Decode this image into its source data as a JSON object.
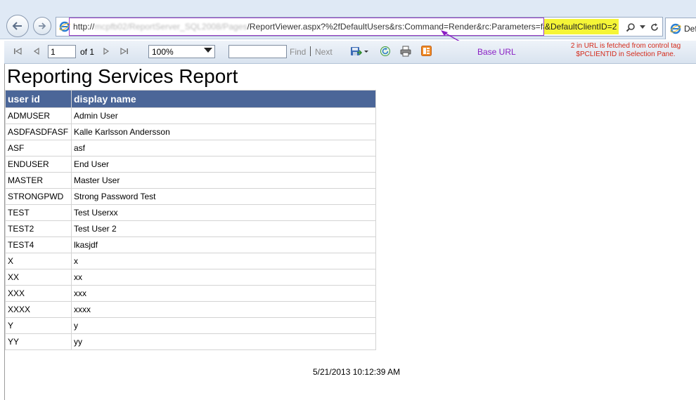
{
  "browser": {
    "url_prefix": "http://",
    "url_blurred": "mcpfb02/ReportServer_SQL2008/Pages",
    "url_path": "/ReportViewer.aspx?%2fDefaultUsers&rs:Command=Render&rc:Parameters=false",
    "url_highlight": "&DefaultClientID=2",
    "tab_label": "Def"
  },
  "toolbar": {
    "page_value": "1",
    "page_of": "of 1",
    "zoom_value": "100%",
    "find_label": "Find",
    "next_label": "Next"
  },
  "annotations": {
    "base_url": "Base URL",
    "note_line1": "2 in URL is fetched from control tag",
    "note_line2": "$PCLIENTID in Selection Pane."
  },
  "report": {
    "title": "Reporting Services Report",
    "columns": [
      "user id",
      "display name"
    ],
    "rows": [
      [
        "ADMUSER",
        "Admin User"
      ],
      [
        "ASDFASDFASF",
        "Kalle Karlsson Andersson"
      ],
      [
        "ASF",
        "asf"
      ],
      [
        "ENDUSER",
        "End User"
      ],
      [
        "MASTER",
        "Master User"
      ],
      [
        "STRONGPWD",
        "Strong Password Test"
      ],
      [
        "TEST",
        "Test Userxx"
      ],
      [
        "TEST2",
        "Test User 2"
      ],
      [
        "TEST4",
        "lkasjdf"
      ],
      [
        "X",
        "x"
      ],
      [
        "XX",
        "xx"
      ],
      [
        "XXX",
        "xxx"
      ],
      [
        "XXXX",
        "xxxx"
      ],
      [
        "Y",
        "y"
      ],
      [
        "YY",
        "yy"
      ]
    ],
    "timestamp": "5/21/2013 10:12:39 AM"
  },
  "colors": {
    "header_bg": "#4b6698",
    "url_highlight": "#f5f537",
    "annotation_purple": "#8a1fc4",
    "note_red": "#d42a1a"
  },
  "icons": [
    "back-arrow-icon",
    "forward-arrow-icon",
    "ie-icon",
    "search-icon",
    "refresh-icon",
    "first-page-icon",
    "previous-page-icon",
    "next-page-icon",
    "last-page-icon",
    "export-icon",
    "print-icon",
    "atom-feed-icon"
  ]
}
